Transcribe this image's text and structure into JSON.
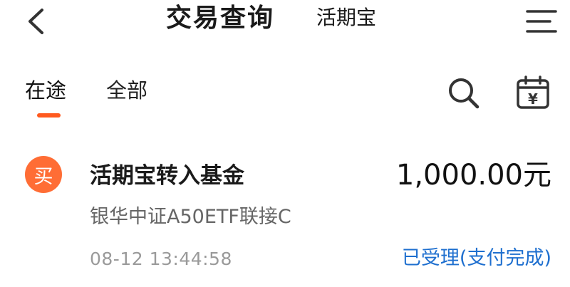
{
  "header": {
    "back_icon": "chevron-left-icon",
    "title": "交易查询",
    "subtitle": "活期宝",
    "menu_icon": "menu-icon"
  },
  "tabs": [
    {
      "label": "在途",
      "active": true
    },
    {
      "label": "全部",
      "active": false
    }
  ],
  "toolbar": {
    "search_icon": "search-icon",
    "calendar_icon": "calendar-yuan-icon",
    "calendar_glyph": "¥"
  },
  "accent_color": "#ff5a1f",
  "status_color": "#1e6fcf",
  "records": [
    {
      "badge": "买",
      "title": "活期宝转入基金",
      "amount": "1,000.00元",
      "fund": "银华中证A50ETF联接C",
      "time": "08-12 13:44:58",
      "status": "已受理(支付完成)"
    }
  ]
}
